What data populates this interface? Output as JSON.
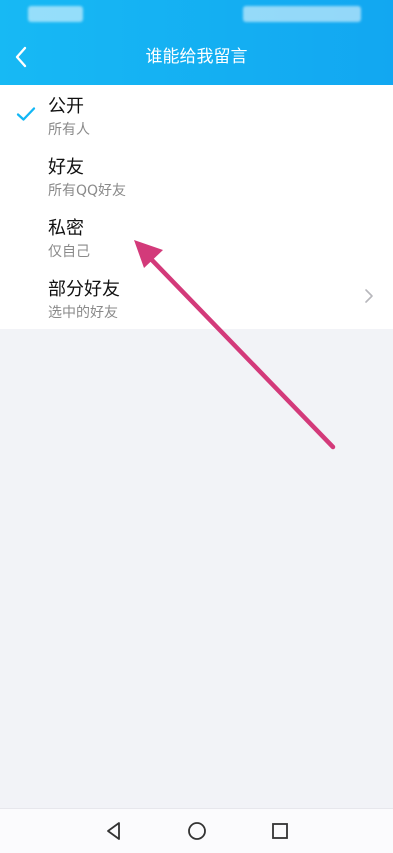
{
  "header": {
    "title": "谁能给我留言"
  },
  "options": [
    {
      "title": "公开",
      "subtitle": "所有人",
      "selected": true
    },
    {
      "title": "好友",
      "subtitle": "所有QQ好友",
      "selected": false
    },
    {
      "title": "私密",
      "subtitle": "仅自己",
      "selected": false
    },
    {
      "title": "部分好友",
      "subtitle": "选中的好友",
      "selected": false
    }
  ],
  "colors": {
    "accent": "#12a7f1",
    "check": "#12b7f5",
    "annotation_arrow": "#d33a7a"
  },
  "icons": {
    "back": "chevron-left-icon",
    "check": "checkmark-icon",
    "more": "chevron-right-icon",
    "nav_back": "triangle-back-icon",
    "nav_home": "circle-home-icon",
    "nav_recent": "square-recent-icon"
  }
}
